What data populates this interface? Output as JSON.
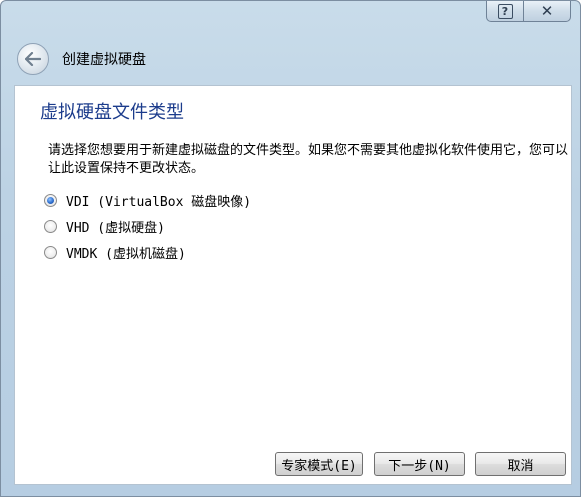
{
  "window": {
    "title_buttons": {
      "help_icon": "help-icon",
      "close_icon": "close-icon"
    }
  },
  "header": {
    "title": "创建虚拟硬盘",
    "back_icon": "back-arrow-icon"
  },
  "page": {
    "title": "虚拟硬盘文件类型",
    "description": "请选择您想要用于新建虚拟磁盘的文件类型。如果您不需要其他虚拟化软件使用它，您可以让此设置保持不更改状态。"
  },
  "options": [
    {
      "label": "VDI (VirtualBox 磁盘映像)",
      "checked": true
    },
    {
      "label": "VHD (虚拟硬盘)",
      "checked": false
    },
    {
      "label": "VMDK (虚拟机磁盘)",
      "checked": false
    }
  ],
  "buttons": {
    "expert": "专家模式(E)",
    "next": "下一步(N)",
    "cancel": "取消"
  },
  "colors": {
    "title_blue": "#1c3c8c",
    "radio_selected": "#2f6fcf"
  }
}
